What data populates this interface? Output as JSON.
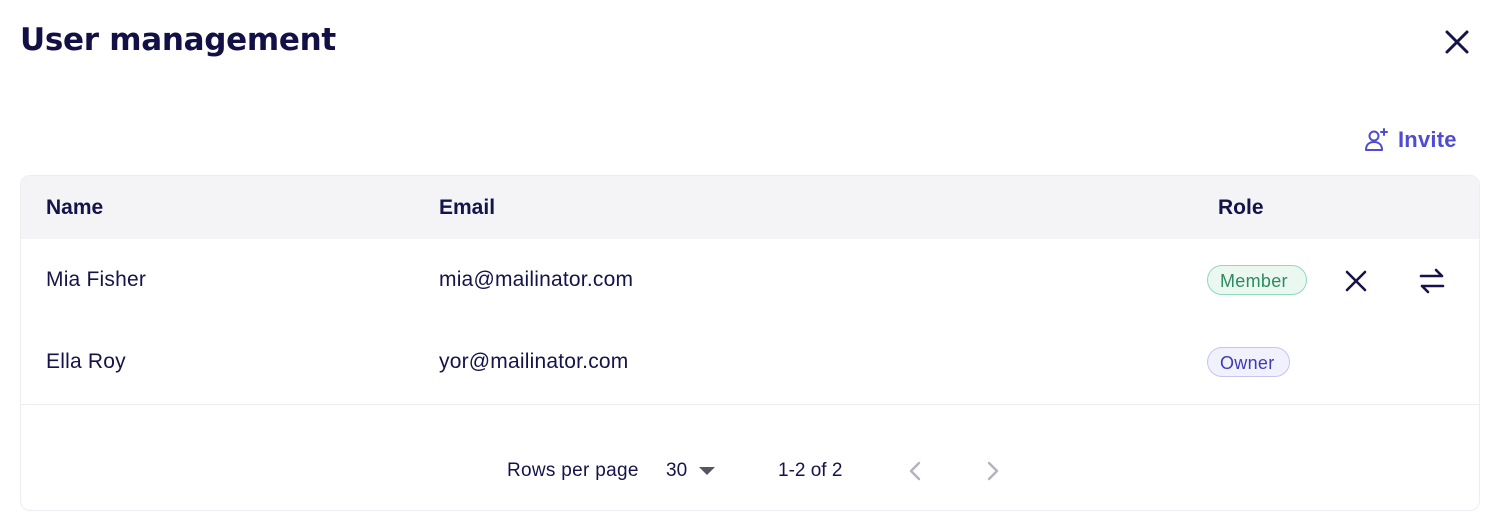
{
  "dialog": {
    "title": "User management",
    "close_icon": "close-icon"
  },
  "toolbar": {
    "invite_label": "Invite",
    "invite_icon": "add-user-icon",
    "accent_color": "#4f4cd1"
  },
  "table": {
    "columns": [
      "Name",
      "Email",
      "Role"
    ],
    "rows": [
      {
        "name": "Mia Fisher",
        "email": "mia@mailinator.com",
        "role": "Member",
        "actions": [
          "remove-icon",
          "transfer-icon"
        ]
      },
      {
        "name": "Ella Roy",
        "email": "yor@mailinator.com",
        "role": "Owner",
        "actions": []
      }
    ]
  },
  "pagination": {
    "rows_per_page_label": "Rows per page",
    "rows_per_page_value": "30",
    "range_text": "1-2 of 2",
    "prev_icon": "chevron-left-icon",
    "next_icon": "chevron-right-icon"
  },
  "colors": {
    "text": "#14134a",
    "member_badge": "#2e8a5f",
    "owner_badge": "#3f3bb5",
    "header_bg": "#f4f4f7"
  }
}
